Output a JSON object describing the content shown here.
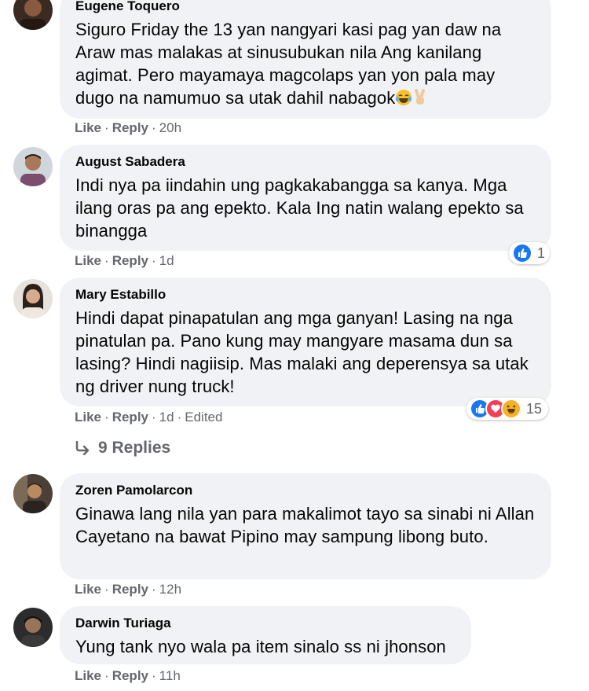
{
  "comments": [
    {
      "author": "Eugene Toquero",
      "text": "Siguro Friday the 13 yan nangyari kasi pag yan daw na Araw mas malakas at sinusubukan nila Ang kanilang agimat. Pero mayamaya magcolaps yan yon pala may dugo na namumuo sa utak dahil nabagok",
      "like": "Like",
      "reply": "Reply",
      "time": "20h"
    },
    {
      "author": "August Sabadera",
      "text": "Indi nya pa iindahin ung pagkakabangga sa kanya. Mga ilang oras pa ang epekto. Kala Ing natin walang epekto sa binangga",
      "like": "Like",
      "reply": "Reply",
      "time": "1d",
      "reaction_count": "1"
    },
    {
      "author": "Mary Estabillo",
      "text": "Hindi dapat pinapatulan ang mga ganyan! Lasing na nga pinatulan pa. Pano kung may mangyare masama dun sa lasing? Hindi nagiisip. Mas malaki ang deperensya sa utak ng driver nung truck!",
      "like": "Like",
      "reply": "Reply",
      "time": "1d",
      "edited": "Edited",
      "reaction_count": "15",
      "replies_label": "9 Replies"
    },
    {
      "author": "Zoren Pamolarcon",
      "text": "Ginawa lang nila yan para makalimot tayo sa sinabi ni Allan Cayetano na bawat Pipino may sampung libong buto.",
      "like": "Like",
      "reply": "Reply",
      "time": "12h"
    },
    {
      "author": "Darwin Turiaga",
      "text": "Yung tank nyo wala pa item sinalo ss ni jhonson",
      "like": "Like",
      "reply": "Reply",
      "time": "11h"
    }
  ],
  "separator": "·",
  "icons": {
    "like": "like-reaction-icon",
    "love": "love-reaction-icon",
    "haha": "haha-reaction-icon",
    "replies_arrow": "reply-arrow-icon",
    "laugh_emoji": "tears-of-joy-emoji",
    "peace_emoji": "victory-hand-emoji"
  },
  "colors": {
    "bubble": "#f0f2f5",
    "meta": "#65676b",
    "like_blue": "#1877f2",
    "love_red": "#f33e58",
    "haha_yellow": "#f7b125"
  }
}
